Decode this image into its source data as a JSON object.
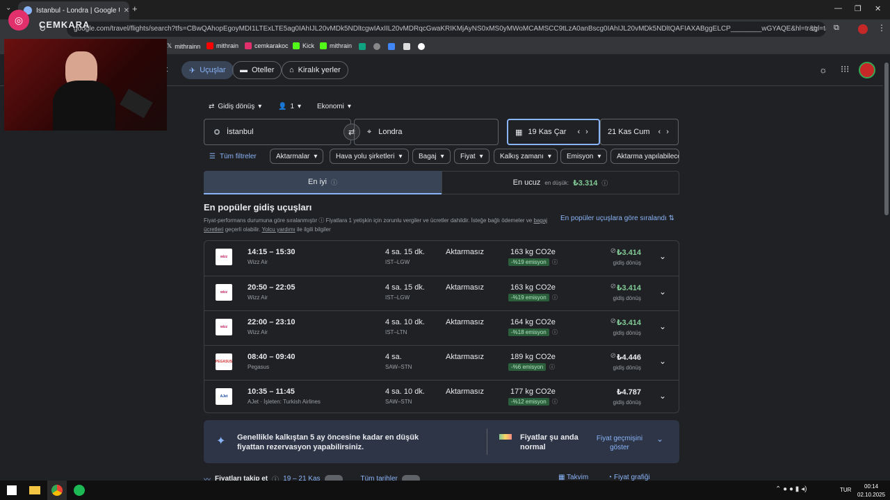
{
  "browser": {
    "tab_title": "İstanbul - Londra | Google Uçuş",
    "url": "google.com/travel/flights/search?tfs=CBwQAhopEgoyMDI1LTExLTE5ag0IAhIJL20vMDk5NDltcgwIAxIIL20vMDRqcGwaKRIKMjAyNS0xMS0yMWoMCAMSCC9tLzA0anBscg0IAhIJL20vMDk5NDltQAFIAXABggELCP________wGYAQE&hl=tr&gl=tr&curr=TRY",
    "overlay_brand": "CEMKARA"
  },
  "bookmarks": [
    {
      "label": "mithrainn",
      "color": "#e8eaed"
    },
    {
      "label": "mithrain",
      "color": "#ff0000"
    },
    {
      "label": "cemkarakoc",
      "color": "#e1306c"
    },
    {
      "label": "Kick",
      "color": "#53fc18"
    },
    {
      "label": "mithrain",
      "color": "#53fc18"
    }
  ],
  "nav": {
    "partial_left": "et",
    "flights": "Uçuşlar",
    "hotels": "Oteller",
    "rentals": "Kiralık yerler"
  },
  "search": {
    "trip_type": "Gidiş dönüş",
    "passengers": "1",
    "cabin": "Ekonomi",
    "origin": "İstanbul",
    "destination": "Londra",
    "depart_date": "19 Kas Çar",
    "return_date": "21 Kas Cum"
  },
  "filters": {
    "all": "Tüm filtreler",
    "chips": [
      "Aktarmalar",
      "Hava yolu şirketleri",
      "Bagaj",
      "Fiyat",
      "Kalkış zamanı",
      "Emisyon",
      "Aktarma yapılabilece"
    ]
  },
  "sort": {
    "best": "En iyi",
    "cheapest": "En ucuz",
    "cheapest_sub": "en düşük:",
    "cheapest_price": "₺3.314"
  },
  "results_header": {
    "title": "En popüler gidiş uçuşları",
    "note_a": "Fiyat-performans durumuna göre sıralanmıştır",
    "note_b": "Fiyatlara 1 yetişkin için zorunlu vergiler ve ücretler dahildir. İsteğe bağlı ödemeler ve",
    "note_link1": "bagaj ücretleri",
    "note_c": "geçerli olabilir.",
    "note_link2": "Yolcu yardımı",
    "note_d": "ile ilgili bilgiler",
    "sort_link": "En popüler uçuşlara göre sıralandı"
  },
  "flights": [
    {
      "time": "14:15 – 15:30",
      "airline": "Wizz Air",
      "logo": "wizz",
      "duration": "4 sa. 15 dk.",
      "route": "IST–LGW",
      "stops": "Aktarmasız",
      "co2": "163 kg CO2e",
      "emission": "-%19 emisyon",
      "price": "₺3.414",
      "price_type": "gidiş dönüş",
      "price_color": "green",
      "no_bag": true
    },
    {
      "time": "20:50 – 22:05",
      "airline": "Wizz Air",
      "logo": "wizz",
      "duration": "4 sa. 15 dk.",
      "route": "IST–LGW",
      "stops": "Aktarmasız",
      "co2": "163 kg CO2e",
      "emission": "-%19 emisyon",
      "price": "₺3.414",
      "price_type": "gidiş dönüş",
      "price_color": "green",
      "no_bag": true
    },
    {
      "time": "22:00 – 23:10",
      "airline": "Wizz Air",
      "logo": "wizz",
      "duration": "4 sa. 10 dk.",
      "route": "IST–LTN",
      "stops": "Aktarmasız",
      "co2": "164 kg CO2e",
      "emission": "-%18 emisyon",
      "price": "₺3.414",
      "price_type": "gidiş dönüş",
      "price_color": "green",
      "no_bag": true
    },
    {
      "time": "08:40 – 09:40",
      "airline": "Pegasus",
      "logo": "pegasus",
      "duration": "4 sa.",
      "route": "SAW–STN",
      "stops": "Aktarmasız",
      "co2": "189 kg CO2e",
      "emission": "-%6 emisyon",
      "price": "₺4.446",
      "price_type": "gidiş dönüş",
      "price_color": "white",
      "no_bag": true
    },
    {
      "time": "10:35 – 11:45",
      "airline": "AJet · İşleten: Turkish Airlines",
      "logo": "ajet",
      "duration": "4 sa. 10 dk.",
      "route": "SAW–STN",
      "stops": "Aktarmasız",
      "co2": "177 kg CO2e",
      "emission": "-%12 emisyon",
      "price": "₺4.787",
      "price_type": "gidiş dönüş",
      "price_color": "white",
      "no_bag": false
    }
  ],
  "insight": {
    "text": "Genellikle kalkıştan 5 ay öncesine kadar en düşük fiyattan rezervasyon yapabilirsiniz.",
    "status": "Fiyatlar şu anda normal",
    "history_link": "Fiyat geçmişini göster"
  },
  "track": {
    "label": "Fiyatları takip et",
    "dates": "19 – 21 Kas",
    "all_dates": "Tüm tarihler",
    "calendar": "Takvim",
    "graph": "Fiyat grafiği"
  },
  "taskbar": {
    "lang": "TUR",
    "time": "00:14",
    "date": "02.10.2025"
  }
}
